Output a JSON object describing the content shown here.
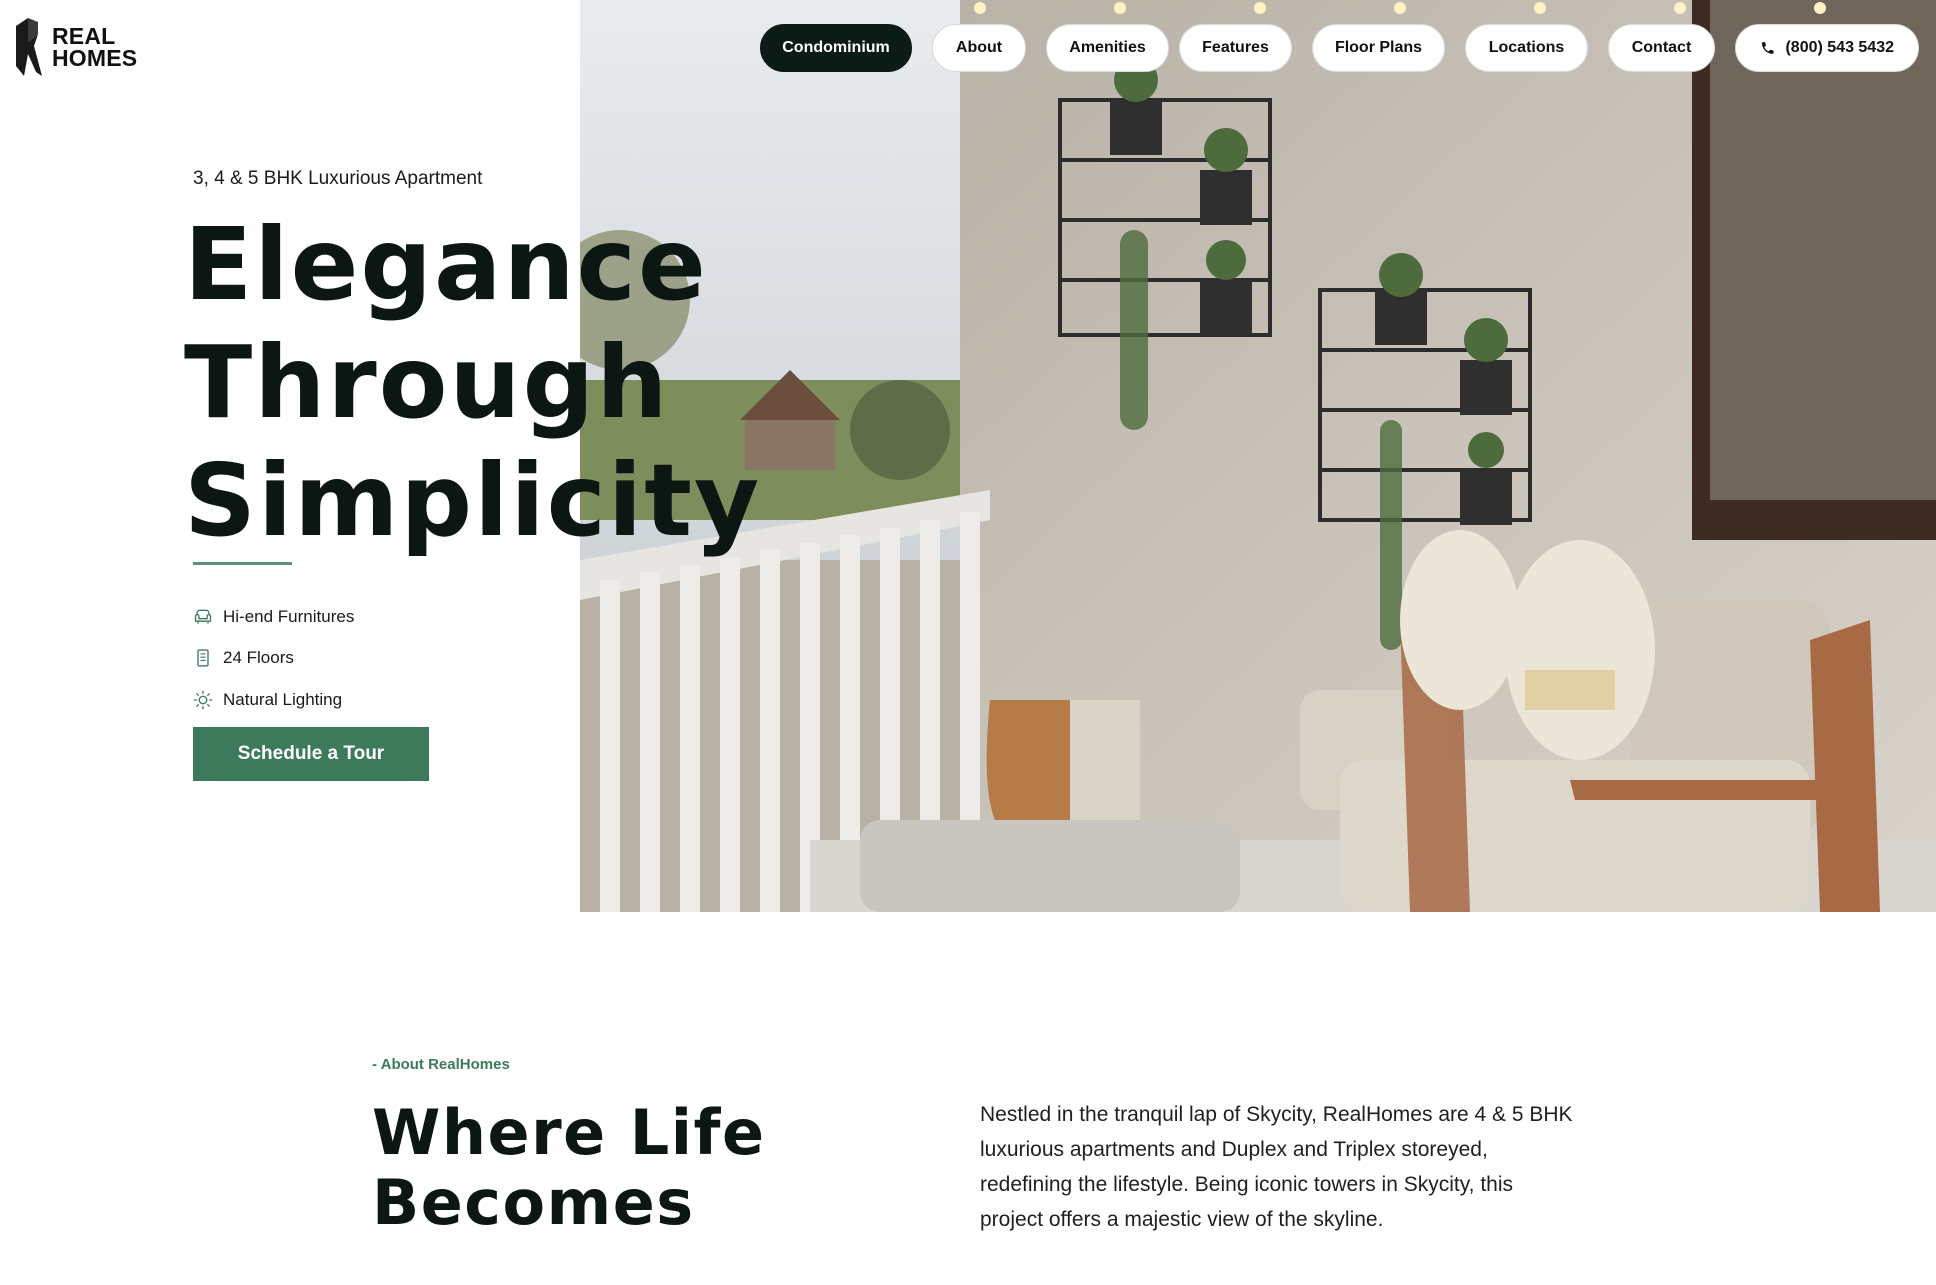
{
  "brand": {
    "line1": "REAL",
    "line2": "HOMES"
  },
  "nav": {
    "items": [
      {
        "label": "Condominium",
        "active": true
      },
      {
        "label": "About"
      },
      {
        "label": "Amenities"
      },
      {
        "label": "Features"
      },
      {
        "label": "Floor Plans"
      },
      {
        "label": "Locations"
      },
      {
        "label": "Contact"
      }
    ],
    "phone": {
      "icon": "phone-icon",
      "label": "(800) 543 5432"
    }
  },
  "hero": {
    "eyebrow": "3, 4 & 5 BHK Luxurious Apartment",
    "title_lines": [
      "Elegance",
      "Through",
      "Simplicity"
    ],
    "features": [
      {
        "icon": "armchair-icon",
        "label": "Hi-end Furnitures"
      },
      {
        "icon": "building-icon",
        "label": "24 Floors"
      },
      {
        "icon": "sun-icon",
        "label": "Natural Lighting"
      }
    ],
    "cta_label": "Schedule a Tour"
  },
  "about": {
    "kicker": "- About RealHomes",
    "title_lines": [
      "Where Life",
      "Becomes"
    ],
    "body": "Nestled in the tranquil lap of Skycity, RealHomes are 4 & 5 BHK luxurious apartments and Duplex and Triplex storeyed, redefining the lifestyle. Being iconic towers in Skycity, this project offers a majestic view of the skyline."
  },
  "colors": {
    "accent": "#3d7a5c",
    "dark": "#0d1b17",
    "rule": "#5e8f77"
  }
}
